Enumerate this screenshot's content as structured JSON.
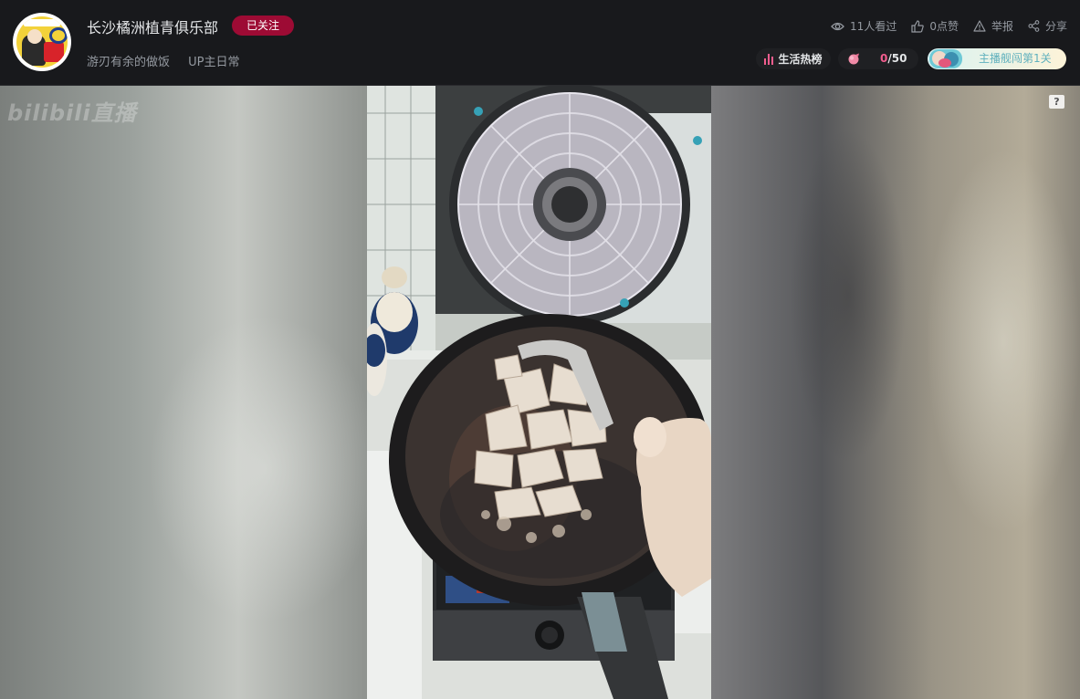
{
  "header": {
    "room_title": "长沙橘洲植青俱乐部",
    "follow_label": "已关注",
    "tags": [
      "游刃有余的做饭",
      "UP主日常"
    ],
    "stats": [
      {
        "icon": "eye-icon",
        "label": "11人看过"
      },
      {
        "icon": "thumbs-up-icon",
        "label": "0点赞"
      },
      {
        "icon": "warning-icon",
        "label": "举报"
      },
      {
        "icon": "share-icon",
        "label": "分享"
      }
    ],
    "rank_label": "生活热榜",
    "gift_current": "0",
    "gift_total": "/50",
    "guard_label": "主播舰闯第1关"
  },
  "player": {
    "watermark": "bilibili直播",
    "help_label": "?"
  },
  "colors": {
    "accent_pink": "#f25d8e",
    "follow_bg": "#9d0b34",
    "header_bg": "#18191c",
    "guard_text": "#5fb0bd"
  }
}
